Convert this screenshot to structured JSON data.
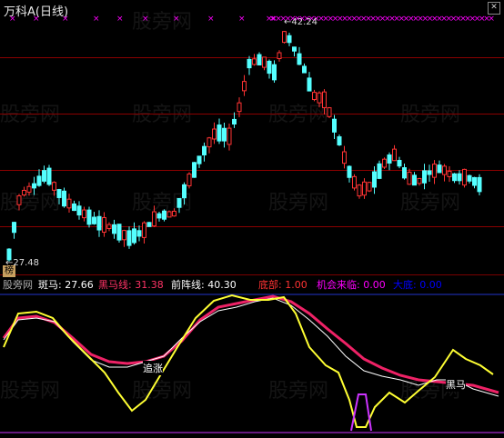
{
  "title": "万科A(日线)",
  "corner_icon": "close-icon",
  "price_chart": {
    "high_label": "42.24",
    "low_label": "27.48",
    "badge": "榜",
    "colors": {
      "up": "#ff3333",
      "down": "#54ffff",
      "marker": "#ff00ff"
    }
  },
  "indicator": {
    "watermark_label": "股旁网",
    "items": [
      {
        "label": "斑马: 27.66",
        "color": "#ffffff"
      },
      {
        "label": "黑马线: 31.38",
        "color": "#ff3366"
      },
      {
        "label": "前阵线: 40.30",
        "color": "#ffffff"
      },
      {
        "label": "底部: 1.00",
        "color": "#ff3333"
      },
      {
        "label": "机会来临: 0.00",
        "color": "#ff00ff"
      },
      {
        "label": "大底: 0.00",
        "color": "#0000ff"
      }
    ],
    "annotations": {
      "chase": "追涨",
      "dark_horse": "黑马"
    },
    "colors": {
      "yellow": "#ffff33",
      "red": "#ee2266",
      "white": "#ffffff",
      "magenta": "#cc33ff"
    }
  },
  "watermark": "股旁网"
}
